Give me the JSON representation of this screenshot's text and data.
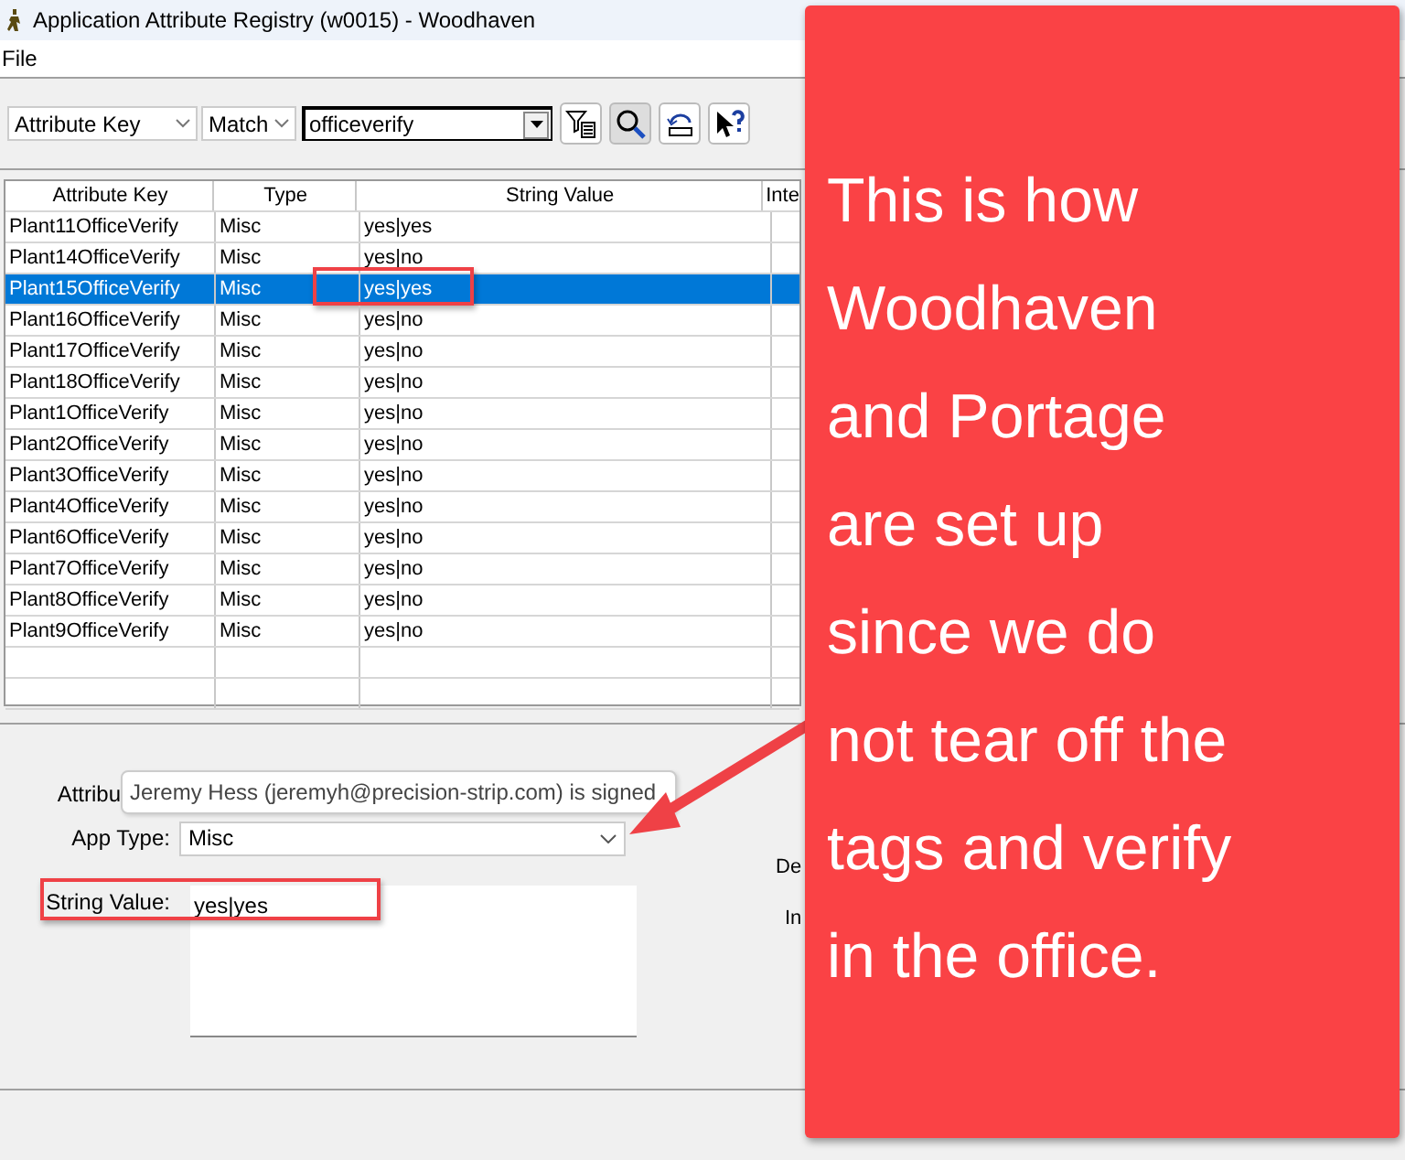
{
  "window": {
    "title": "Application Attribute Registry (w0015) - Woodhaven"
  },
  "menu": [
    "File"
  ],
  "toolbar": {
    "key_filter": "Attribute Key",
    "match": "Match",
    "search_value": "officeverify"
  },
  "table": {
    "columns": [
      "Attribute Key",
      "Type",
      "String Value",
      "Inte"
    ],
    "rows": [
      {
        "key": "Plant11OfficeVerify",
        "type": "Misc",
        "value": "yes|yes",
        "selected": false,
        "highlighted": false
      },
      {
        "key": "Plant14OfficeVerify",
        "type": "Misc",
        "value": "yes|no",
        "selected": false,
        "highlighted": false
      },
      {
        "key": "Plant15OfficeVerify",
        "type": "Misc",
        "value": "yes|yes",
        "selected": true,
        "highlighted": true
      },
      {
        "key": "Plant16OfficeVerify",
        "type": "Misc",
        "value": "yes|no",
        "selected": false,
        "highlighted": false
      },
      {
        "key": "Plant17OfficeVerify",
        "type": "Misc",
        "value": "yes|no",
        "selected": false,
        "highlighted": false
      },
      {
        "key": "Plant18OfficeVerify",
        "type": "Misc",
        "value": "yes|no",
        "selected": false,
        "highlighted": false
      },
      {
        "key": "Plant1OfficeVerify",
        "type": "Misc",
        "value": "yes|no",
        "selected": false,
        "highlighted": false
      },
      {
        "key": "Plant2OfficeVerify",
        "type": "Misc",
        "value": "yes|no",
        "selected": false,
        "highlighted": false
      },
      {
        "key": "Plant3OfficeVerify",
        "type": "Misc",
        "value": "yes|no",
        "selected": false,
        "highlighted": false
      },
      {
        "key": "Plant4OfficeVerify",
        "type": "Misc",
        "value": "yes|no",
        "selected": false,
        "highlighted": false
      },
      {
        "key": "Plant6OfficeVerify",
        "type": "Misc",
        "value": "yes|no",
        "selected": false,
        "highlighted": false
      },
      {
        "key": "Plant7OfficeVerify",
        "type": "Misc",
        "value": "yes|no",
        "selected": false,
        "highlighted": false
      },
      {
        "key": "Plant8OfficeVerify",
        "type": "Misc",
        "value": "yes|no",
        "selected": false,
        "highlighted": false
      },
      {
        "key": "Plant9OfficeVerify",
        "type": "Misc",
        "value": "yes|no",
        "selected": false,
        "highlighted": false
      }
    ]
  },
  "form": {
    "attribute_label": "Attribu",
    "tooltip": "Jeremy Hess (jeremyh@precision-strip.com) is signed",
    "app_type_label": "App Type:",
    "app_type_value": "Misc",
    "string_value_label": "String Value:",
    "string_value": "yes|yes",
    "string_value_highlighted": true,
    "right_labels": [
      "De",
      "In"
    ]
  },
  "callout": {
    "lines": [
      "This is how",
      "Woodhaven",
      "and Portage",
      "are set up",
      "since we do",
      "not tear off the",
      "tags and verify",
      "in the office."
    ]
  }
}
